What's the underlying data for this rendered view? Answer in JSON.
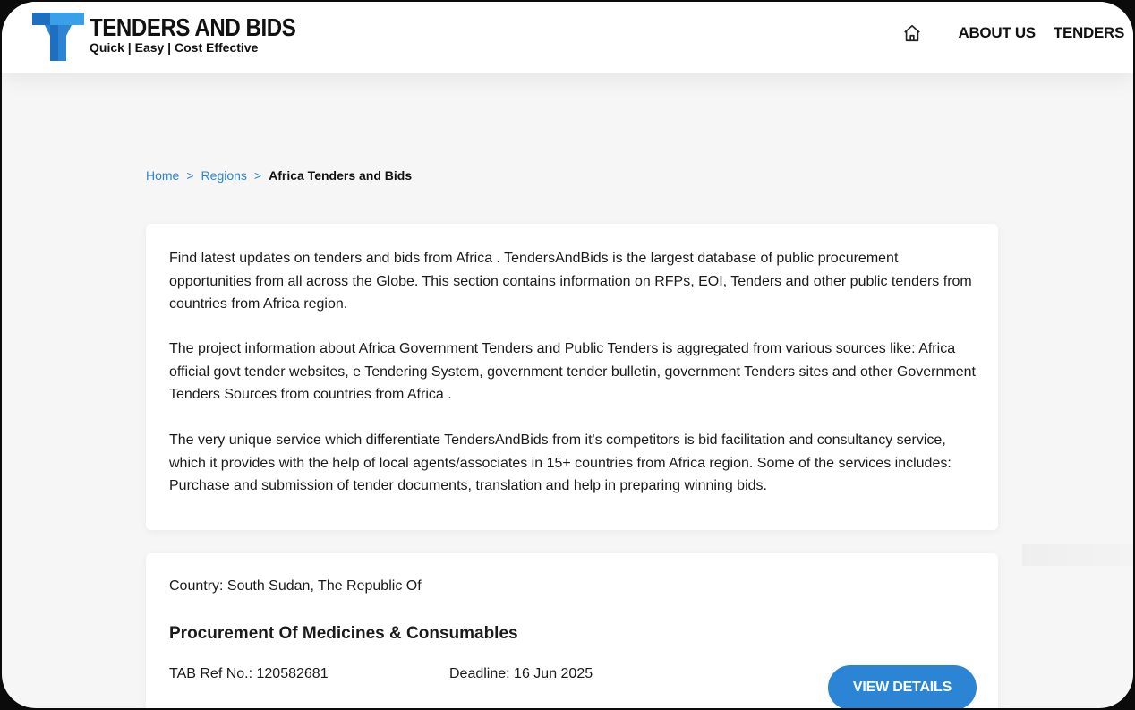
{
  "brand": {
    "name": "TENDERS AND BIDS",
    "tagline": "Quick | Easy | Cost Effective",
    "colors": {
      "primary": "#2b84d4",
      "logo_dark": "#1f6fc0",
      "logo_light": "#3aa0e8"
    }
  },
  "nav": {
    "home_icon": "home-icon",
    "items": [
      {
        "label": "ABOUT US"
      },
      {
        "label": "TENDERS"
      }
    ]
  },
  "breadcrumb": {
    "items": [
      "Home",
      "Regions"
    ],
    "separator": ">",
    "current": "Africa Tenders and Bids"
  },
  "intro": {
    "paragraphs": [
      "Find latest updates on tenders and bids from Africa . TendersAndBids is the largest database of public procurement opportunities from all across the Globe. This section contains information on RFPs, EOI, Tenders and other public tenders from countries from Africa region.",
      "The project information about Africa Government Tenders and Public Tenders is aggregated from various sources like: Africa official govt tender websites, e Tendering System, government tender bulletin, government Tenders sites and other Government Tenders Sources from countries from Africa .",
      "The very unique service which differentiate TendersAndBids from it's competitors is bid facilitation and consultancy service, which it provides with the help of local agents/associates in 15+ countries from Africa region. Some of the services includes: Purchase and submission of tender documents, translation and help in preparing winning bids."
    ]
  },
  "tenders": [
    {
      "country": "Country: South Sudan, The Republic Of",
      "title": "Procurement Of Medicines & Consumables",
      "ref": "TAB Ref No.: 120582681",
      "deadline": "Deadline: 16 Jun 2025",
      "button_label": "VIEW DETAILS"
    }
  ]
}
